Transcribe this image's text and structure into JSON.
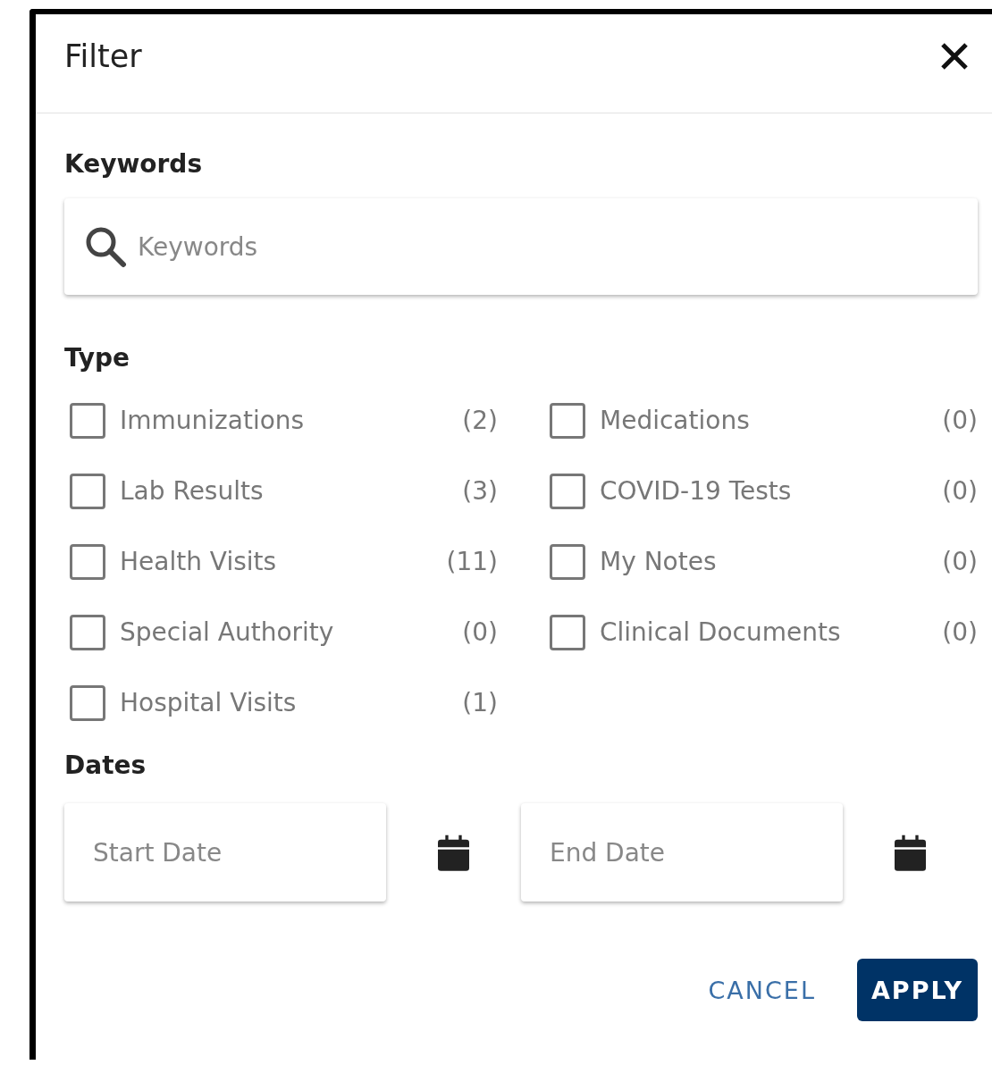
{
  "dialog": {
    "title": "Filter"
  },
  "keywords": {
    "heading": "Keywords",
    "placeholder": "Keywords"
  },
  "type": {
    "heading": "Type",
    "columns": [
      [
        {
          "label": "Immunizations",
          "count": "(2)",
          "checked": false
        },
        {
          "label": "Lab Results",
          "count": "(3)",
          "checked": false
        },
        {
          "label": "Health Visits",
          "count": "(11)",
          "checked": false
        },
        {
          "label": "Special Authority",
          "count": "(0)",
          "checked": false
        },
        {
          "label": "Hospital Visits",
          "count": "(1)",
          "checked": false
        }
      ],
      [
        {
          "label": "Medications",
          "count": "(0)",
          "checked": false
        },
        {
          "label": "COVID-19 Tests",
          "count": "(0)",
          "checked": false
        },
        {
          "label": "My Notes",
          "count": "(0)",
          "checked": false
        },
        {
          "label": "Clinical Documents",
          "count": "(0)",
          "checked": false
        }
      ]
    ]
  },
  "dates": {
    "heading": "Dates",
    "start": {
      "placeholder": "Start Date"
    },
    "end": {
      "placeholder": "End Date"
    }
  },
  "buttons": [
    {
      "label": "CANCEL",
      "kind": "text"
    },
    {
      "label": "APPLY",
      "kind": "primary"
    }
  ]
}
